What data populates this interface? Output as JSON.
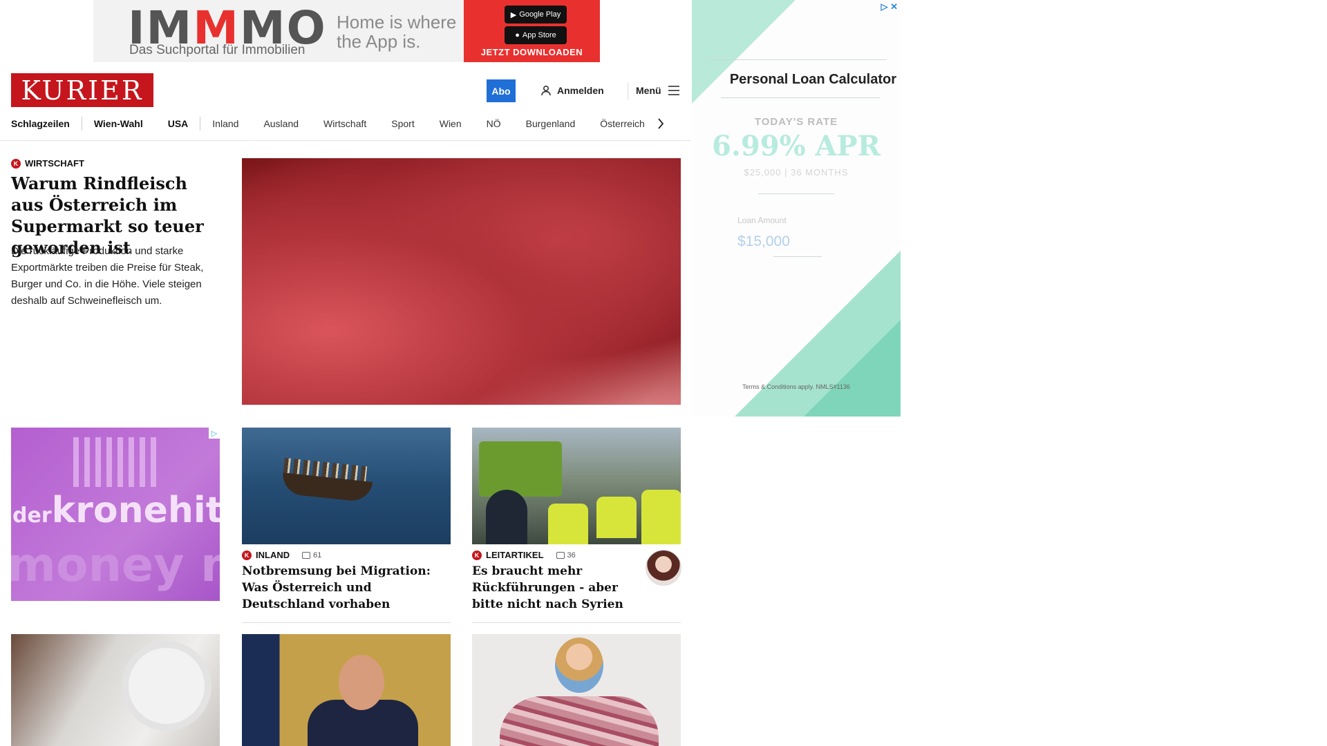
{
  "top_ad": {
    "brand_prefix": "IM",
    "brand_mid": "M",
    "brand_suffix": "MO",
    "subtitle": "Das Suchportal für Immobilien",
    "tagline": "Home is where the App is.",
    "google_play": "Google Play",
    "app_store": "App Store",
    "cta": "JETZT DOWNLOADEN"
  },
  "header": {
    "logo": "KURIER",
    "abo": "Abo",
    "login": "Anmelden",
    "menu": "Menü"
  },
  "nav": {
    "items": [
      "Schlagzeilen",
      "Wien-Wahl",
      "USA",
      "Inland",
      "Ausland",
      "Wirtschaft",
      "Sport",
      "Wien",
      "NÖ",
      "Burgenland",
      "Österreich"
    ]
  },
  "hero": {
    "kicker": "WIRTSCHAFT",
    "title": "Warum Rindfleisch aus Österreich im Supermarkt so teuer geworden ist",
    "teaser": "Die rückläufige Produktion und starke Exportmärkte treiben die Preise für Steak, Burger und Co. in die Höhe. Viele steigen deshalb auf Schweinefleisch um."
  },
  "promo_ad": {
    "prefix": "der",
    "word": "kronehit",
    "ghost": "money m"
  },
  "cards": [
    {
      "kicker": "INLAND",
      "comments": "61",
      "title": "Notbremsung bei Migration: Was Österreich und Deutschland vorhaben"
    },
    {
      "kicker": "LEITARTIKEL",
      "comments": "36",
      "title": "Es braucht mehr Rückführungen - aber bitte nicht nach Syrien"
    }
  ],
  "side_ad": {
    "title": "Personal Loan Calculator",
    "rate_label": "TODAY'S RATE",
    "rate": "6.99% APR",
    "rate_terms": "$25,000 | 36 MONTHS",
    "loan_label": "Loan Amount",
    "loan_value": "$15,000",
    "terms": "Terms & Conditions apply. NMLS#1136"
  },
  "colors": {
    "brand_red": "#c4161c",
    "abo_blue": "#1f6fd6",
    "ad_mint": "#a6e3cf"
  }
}
